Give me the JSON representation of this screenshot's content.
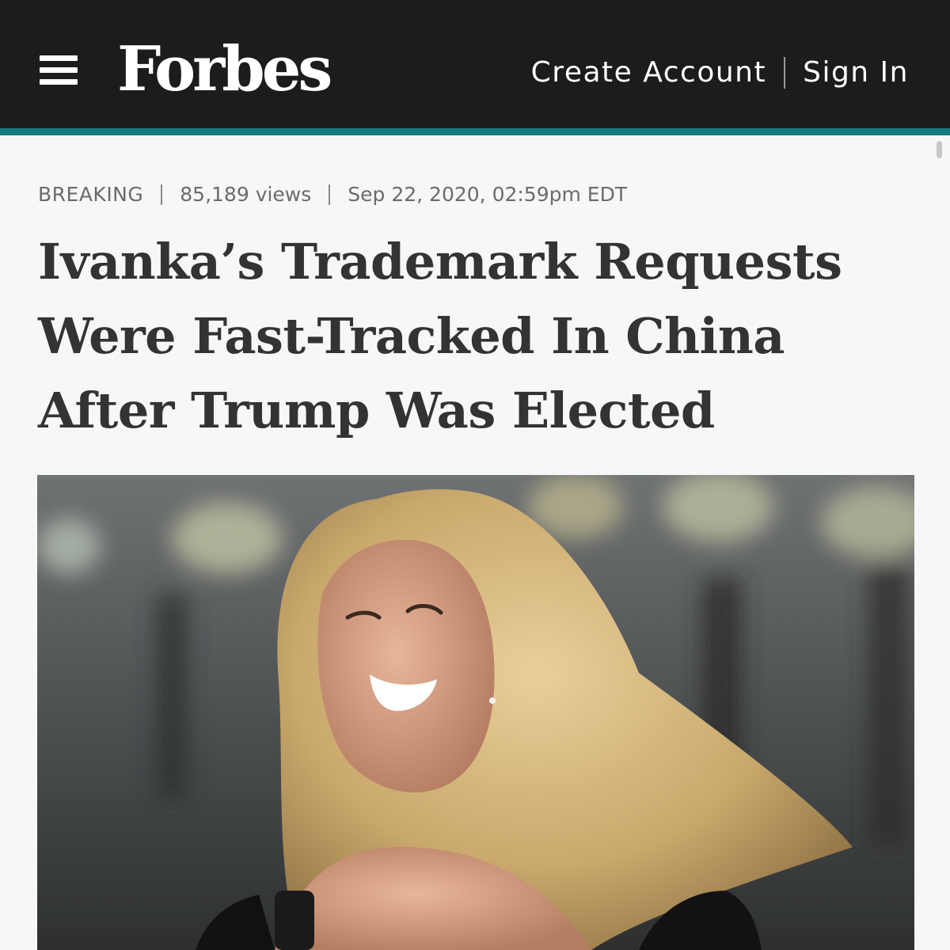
{
  "header": {
    "brand": "Forbes",
    "create_account": "Create Account",
    "sign_in": "Sign In",
    "colors": {
      "bar": "#1c1c1c",
      "accent": "#157b83"
    }
  },
  "article": {
    "category": "BREAKING",
    "views": "85,189 views",
    "date": "Sep 22, 2020, 02:59pm EDT",
    "headline": "Ivanka’s Trademark Requests Were Fast-Tracked In China After Trump Was Elected"
  },
  "icons": {
    "menu": "hamburger-menu-icon"
  }
}
